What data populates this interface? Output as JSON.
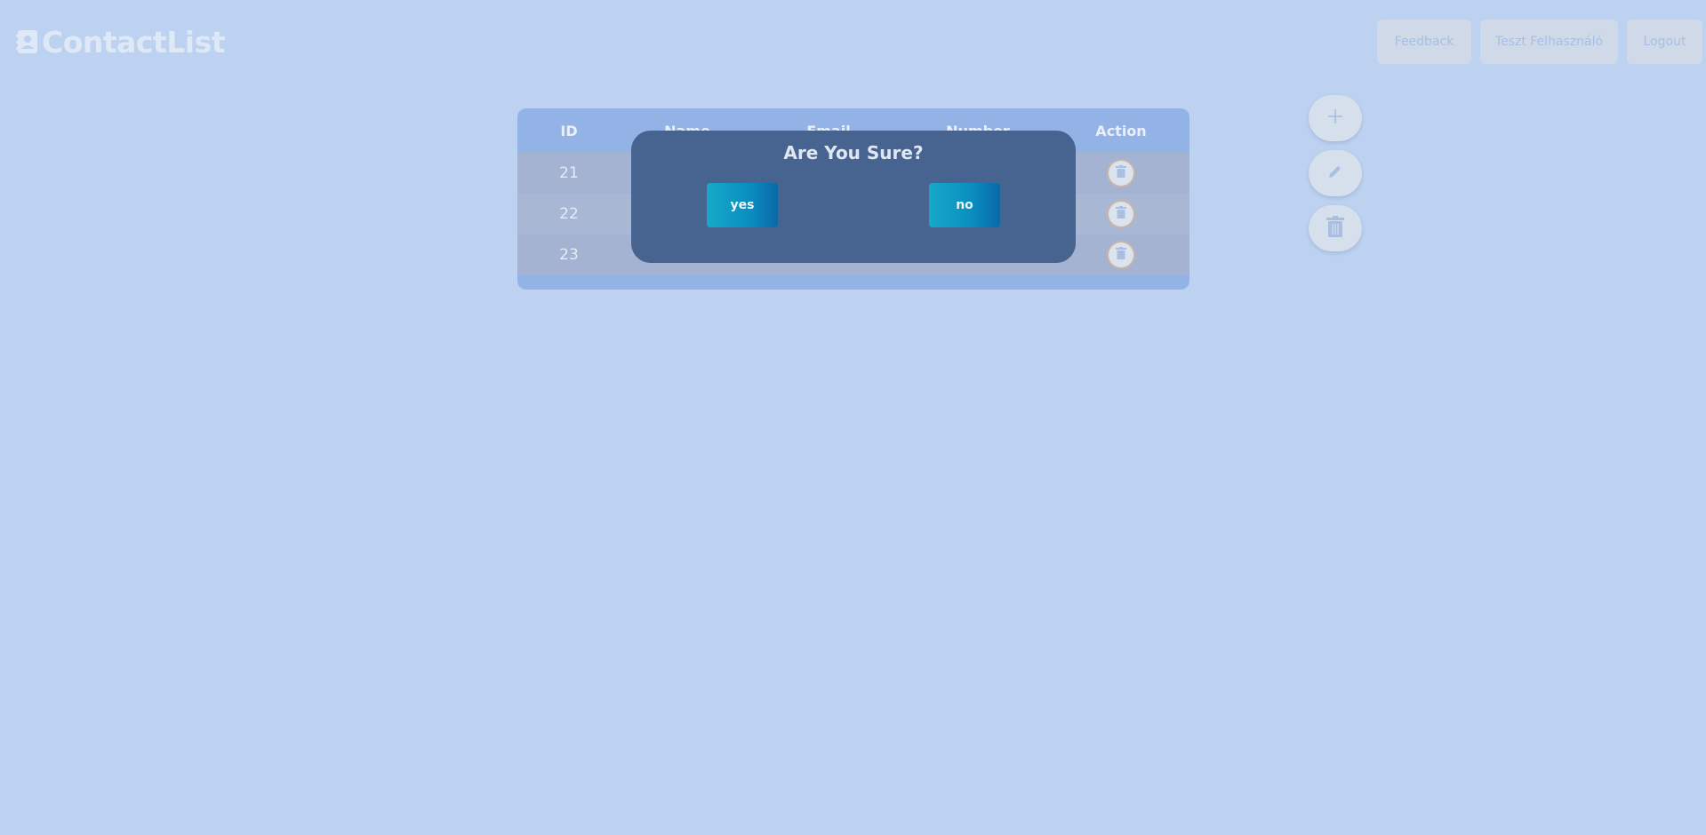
{
  "header": {
    "logo_text": "ContactList",
    "logo_icon": "contact-book-icon",
    "buttons": {
      "feedback": "Feedback",
      "user": "Teszt Felhasználó",
      "logout": "Logout"
    }
  },
  "table": {
    "headers": {
      "id": "ID",
      "name": "Name",
      "email": "Email",
      "number": "Number",
      "action": "Action"
    },
    "rows": [
      {
        "id": "21"
      },
      {
        "id": "22"
      },
      {
        "id": "23"
      }
    ],
    "row_action_icon": "trash-icon"
  },
  "side_actions": [
    {
      "icon": "plus-icon"
    },
    {
      "icon": "pencil-icon"
    },
    {
      "icon": "trash-icon"
    }
  ],
  "modal": {
    "title": "Are You Sure?",
    "yes_label": "yes",
    "no_label": "no"
  },
  "colors": {
    "background": "#bdd2f0",
    "table_header": "#93b2e6",
    "modal_bg": "#476390",
    "button_gradient_start": "#16a9c8",
    "button_gradient_end": "#0a68a8"
  }
}
